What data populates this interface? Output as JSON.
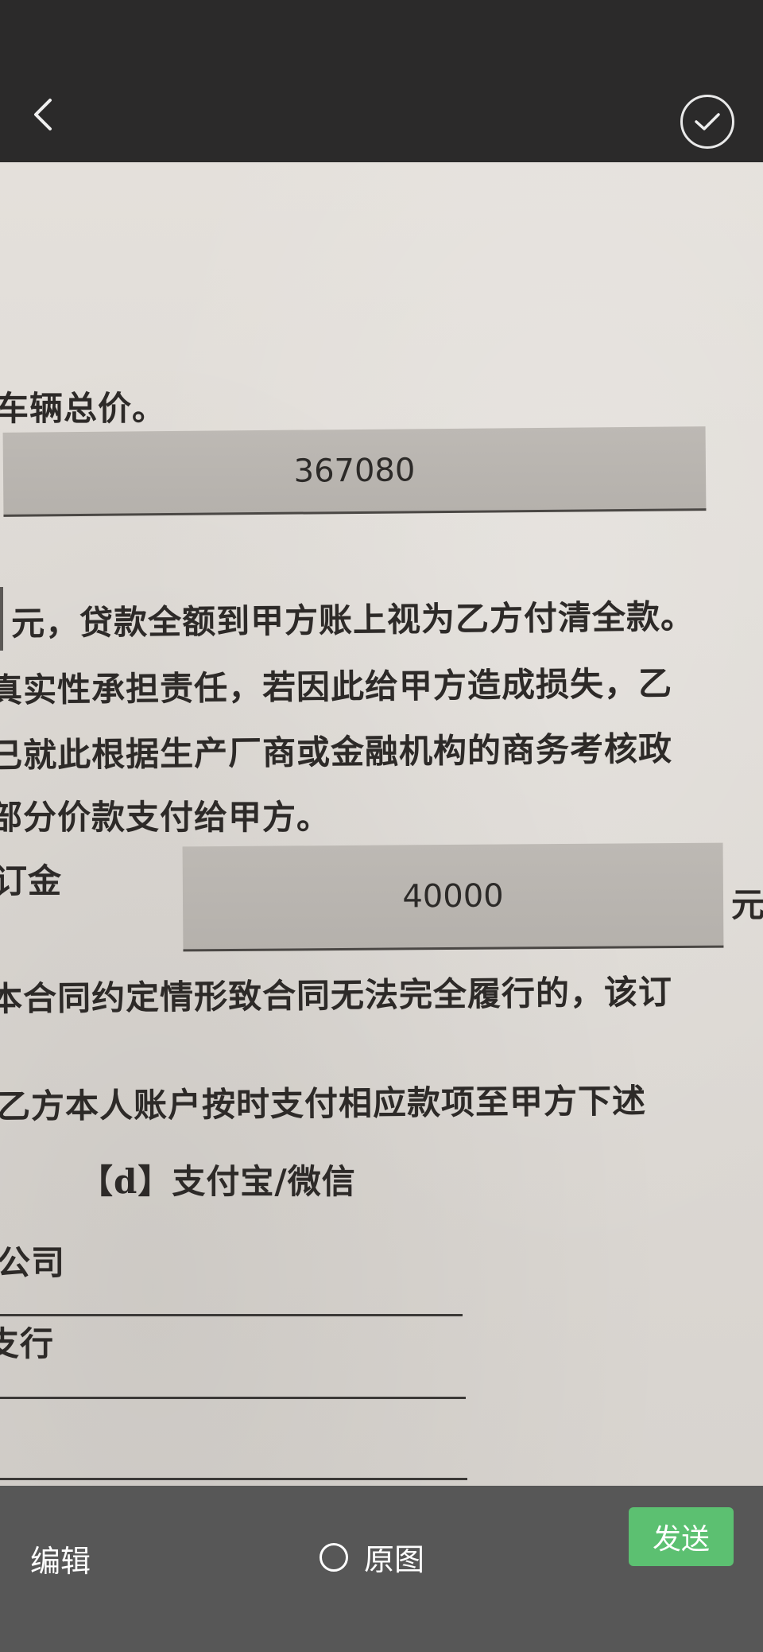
{
  "topbar": {
    "back_icon": "chevron-left-icon",
    "confirm_icon": "check-circle-icon"
  },
  "document": {
    "line_total_price": "车辆总价。",
    "total_price_value": "367080",
    "line_loan": "元，贷款全额到甲方账上视为乙方付清全款。",
    "line_truthfulness": "真实性承担责任，若因此给甲方造成损失，乙",
    "line_already": "已就此根据生产厂商或金融机构的商务考核政",
    "line_payment": "部分价款支付给甲方。",
    "deposit_label": "订金",
    "deposit_value": "40000",
    "deposit_unit": "元",
    "line_contract": "本合同约定情形致合同无法完全履行的，该订",
    "line_account": "乙方本人账户按时支付相应款项至甲方下述",
    "line_option_d": "【d】支付宝/微信",
    "line_company": "公司",
    "line_branch": "支行"
  },
  "bottombar": {
    "edit_label": "编辑",
    "original_label": "原图",
    "send_label": "发送"
  },
  "colors": {
    "send_button": "#5cc071",
    "bars": "#2b2a2a",
    "bottom_bar": "#575757"
  }
}
